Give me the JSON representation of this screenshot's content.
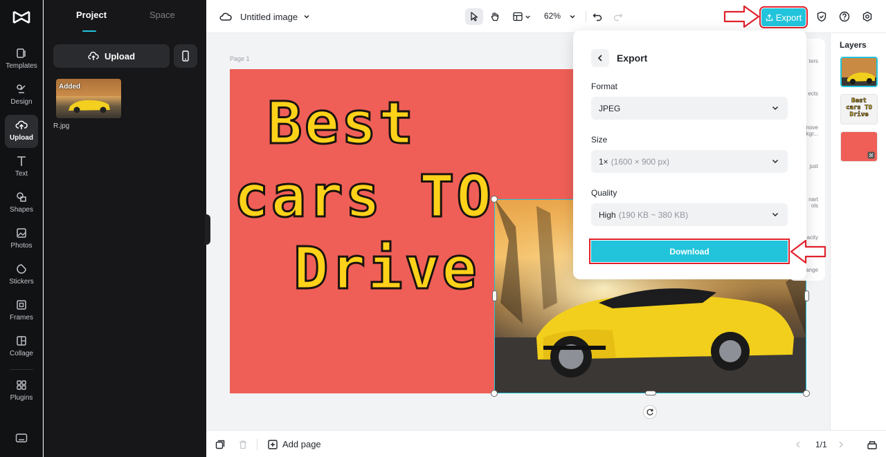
{
  "rail": {
    "items": [
      {
        "label": "Templates",
        "icon": "templates-icon"
      },
      {
        "label": "Design",
        "icon": "design-icon"
      },
      {
        "label": "Upload",
        "icon": "upload-icon"
      },
      {
        "label": "Text",
        "icon": "text-icon"
      },
      {
        "label": "Shapes",
        "icon": "shapes-icon"
      },
      {
        "label": "Photos",
        "icon": "photos-icon"
      },
      {
        "label": "Stickers",
        "icon": "stickers-icon"
      },
      {
        "label": "Frames",
        "icon": "frames-icon"
      },
      {
        "label": "Collage",
        "icon": "collage-icon"
      },
      {
        "label": "Plugins",
        "icon": "plugins-icon"
      }
    ],
    "active": "Upload"
  },
  "panel": {
    "tabs": [
      "Project",
      "Space"
    ],
    "active_tab": "Project",
    "upload_label": "Upload",
    "files": [
      {
        "badge": "Added",
        "name": "R.jpg"
      }
    ]
  },
  "topbar": {
    "doc_title": "Untitled image",
    "zoom": "62%",
    "export_label": "Export"
  },
  "canvas": {
    "page_label": "Page 1",
    "headline": [
      "Best",
      "cars TO",
      "Drive"
    ]
  },
  "tool_column": {
    "items": [
      "ters",
      "ects",
      "nove\nkgr...",
      "just",
      "nart\nols",
      "acity",
      "ange"
    ]
  },
  "layers": {
    "title": "Layers",
    "thumb_text": "Best cars TO Drive"
  },
  "bottombar": {
    "add_page": "Add page",
    "pagination": "1/1"
  },
  "export_popover": {
    "title": "Export",
    "format_label": "Format",
    "format_value": "JPEG",
    "size_label": "Size",
    "size_value": "1×",
    "size_detail": "(1600 × 900 px)",
    "quality_label": "Quality",
    "quality_value": "High",
    "quality_detail": "(190 KB ~ 380 KB)",
    "download_label": "Download"
  },
  "colors": {
    "accent": "#22c4dc",
    "annotation": "#e0202a",
    "page_bg": "#ef5f57",
    "headline": "#ffd21a"
  }
}
